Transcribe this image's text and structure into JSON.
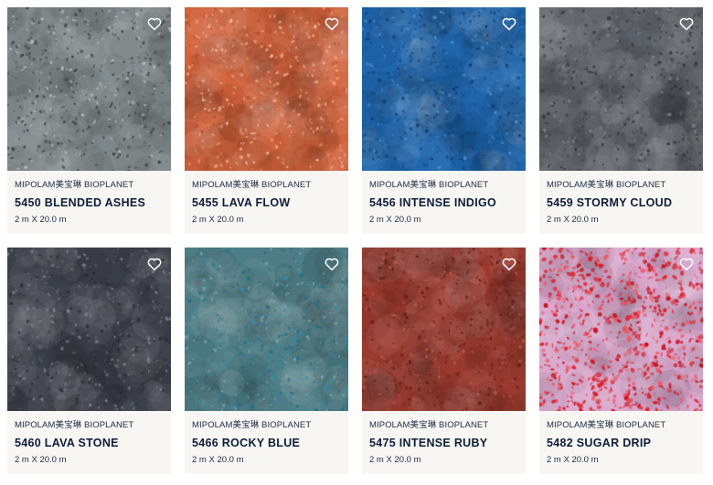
{
  "products": [
    {
      "brand": "MIPOLAM美宝琳 BIOPLANET",
      "name": "5450 BLENDED ASHES",
      "size": "2 m X 20.0 m",
      "base_color": "#7d8688",
      "speck_colors": [
        "#4a5152",
        "#3b4142",
        "#b7bdbd"
      ],
      "favorite_icon": "heart-outline-icon"
    },
    {
      "brand": "MIPOLAM美宝琳 BIOPLANET",
      "name": "5455 LAVA FLOW",
      "size": "2 m X 20.0 m",
      "base_color": "#d2633b",
      "speck_colors": [
        "#e8a07e",
        "#b8502d",
        "#f0b394"
      ],
      "favorite_icon": "heart-outline-icon"
    },
    {
      "brand": "MIPOLAM美宝琳 BIOPLANET",
      "name": "5456 INTENSE INDIGO",
      "size": "2 m X 20.0 m",
      "base_color": "#1f66ad",
      "speck_colors": [
        "#154f8a",
        "#4a8bc8",
        "#123f70"
      ],
      "favorite_icon": "heart-outline-icon"
    },
    {
      "brand": "MIPOLAM美宝琳 BIOPLANET",
      "name": "5459 STORMY CLOUD",
      "size": "2 m X 20.0 m",
      "base_color": "#5b5f66",
      "speck_colors": [
        "#3f4248",
        "#7c8088",
        "#34373c"
      ],
      "favorite_icon": "heart-outline-icon"
    },
    {
      "brand": "MIPOLAM美宝琳 BIOPLANET",
      "name": "5460 LAVA STONE",
      "size": "2 m X 20.0 m",
      "base_color": "#3b3f48",
      "speck_colors": [
        "#5d626c",
        "#2a2d34",
        "#7a7f88"
      ],
      "favorite_icon": "heart-outline-icon"
    },
    {
      "brand": "MIPOLAM美宝琳 BIOPLANET",
      "name": "5466 ROCKY BLUE",
      "size": "2 m X 20.0 m",
      "base_color": "#4e7d85",
      "speck_colors": [
        "#2a8fb0",
        "#1f6f8a",
        "#7aa3aa"
      ],
      "favorite_icon": "heart-outline-icon"
    },
    {
      "brand": "MIPOLAM美宝琳 BIOPLANET",
      "name": "5475 INTENSE RUBY",
      "size": "2 m X 20.0 m",
      "base_color": "#9a3a2f",
      "speck_colors": [
        "#7a2b22",
        "#b8584a",
        "#5e2019"
      ],
      "favorite_icon": "heart-outline-icon"
    },
    {
      "brand": "MIPOLAM美宝琳 BIOPLANET",
      "name": "5482 SUGAR DRIP",
      "size": "2 m X 20.0 m",
      "base_color": "#d8a6cc",
      "speck_colors": [
        "#e0202a",
        "#c8101c",
        "#f05560"
      ],
      "favorite_icon": "heart-outline-icon"
    }
  ]
}
